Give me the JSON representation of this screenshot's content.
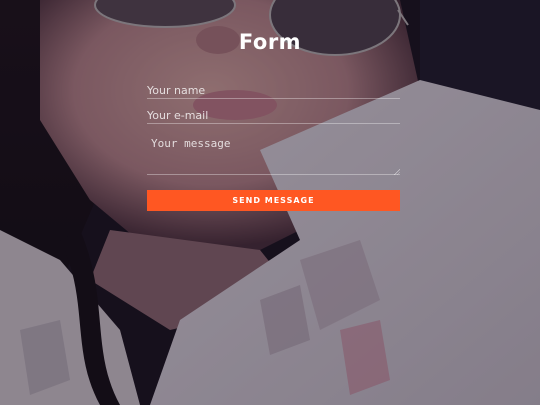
{
  "form": {
    "title": "Form",
    "name_placeholder": "Your name",
    "email_placeholder": "Your e-mail",
    "message_placeholder": "Your message",
    "submit_label": "SEND MESSAGE",
    "accent_color": "#ff5722"
  },
  "background": {
    "description_icon": "portrait-photo"
  }
}
